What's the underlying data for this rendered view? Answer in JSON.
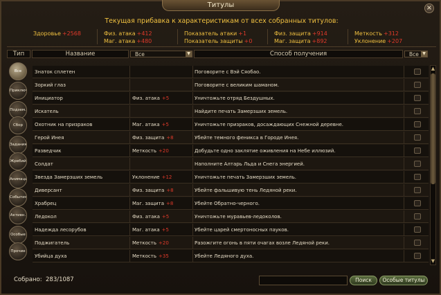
{
  "window": {
    "title": "Титулы",
    "close_glyph": "×"
  },
  "bonus": {
    "title": "Текущая прибавка к характеристикам от всех собранных титулов:",
    "stats": [
      {
        "label": "Здоровье",
        "value": "+2568"
      },
      {
        "label": "Физ. атака",
        "value": "+412"
      },
      {
        "label": "Маг. атака",
        "value": "+480"
      },
      {
        "label": "Показатель атаки",
        "value": "+1"
      },
      {
        "label": "Показатель защиты",
        "value": "+0"
      },
      {
        "label": "Физ. защита",
        "value": "+914"
      },
      {
        "label": "Маг. защита",
        "value": "+892"
      },
      {
        "label": "Меткость",
        "value": "+312"
      },
      {
        "label": "Уклонение",
        "value": "+207"
      }
    ]
  },
  "columns": {
    "type": "Тип",
    "name": "Название",
    "bonus_filter": "Все",
    "how": "Способ получения",
    "status_filter": "Все"
  },
  "filters": [
    "Все",
    "Приключ.",
    "Подзем.",
    "Сбор",
    "Задания",
    "Жребий",
    "Анимация",
    "События",
    "Активн.",
    "Особые",
    "Прочие"
  ],
  "rows": [
    {
      "name": "Знаток сплетен",
      "bonus": "",
      "bonus_value": "",
      "how": "Поговорите с Вэй Сяобао."
    },
    {
      "name": "Зоркий глаз",
      "bonus": "",
      "bonus_value": "",
      "how": "Поговорите с великим шаманом."
    },
    {
      "name": "Инициатор",
      "bonus": "Физ. атака",
      "bonus_value": "+5",
      "how": "Уничтожьте отряд Бездушных."
    },
    {
      "name": "Искатель",
      "bonus": "",
      "bonus_value": "",
      "how": "Найдите печать Замерзших земель."
    },
    {
      "name": "Охотник на призраков",
      "bonus": "Маг. атака",
      "bonus_value": "+5",
      "how": "Уничтожьте призраков, досаждающих Снежной деревне."
    },
    {
      "name": "Герой Инея",
      "bonus": "Физ. защита",
      "bonus_value": "+8",
      "how": "Убейте темного феникса в Городе Инея."
    },
    {
      "name": "Разведчик",
      "bonus": "Меткость",
      "bonus_value": "+20",
      "how": "Добудьте одно заклятие оживления на Небе иллюзий."
    },
    {
      "name": "Солдат",
      "bonus": "",
      "bonus_value": "",
      "how": "Наполните Алтарь Льда и Снега энергией."
    },
    {
      "name": "Звезда Замерзших земель",
      "bonus": "Уклонение",
      "bonus_value": "+12",
      "how": "Уничтожьте печать Замерзших земель."
    },
    {
      "name": "Диверсант",
      "bonus": "Физ. защита",
      "bonus_value": "+8",
      "how": "Убейте фальшивую тень Ледяной реки."
    },
    {
      "name": "Храбрец",
      "bonus": "Маг. защита",
      "bonus_value": "+8",
      "how": "Убейте Обратно-черного."
    },
    {
      "name": "Ледокол",
      "bonus": "Физ. атака",
      "bonus_value": "+5",
      "how": "Уничтожьте муравьев-ледоколов."
    },
    {
      "name": "Надежда лесорубов",
      "bonus": "Маг. атака",
      "bonus_value": "+5",
      "how": "Убейте царей смертоносных пауков."
    },
    {
      "name": "Поджигатель",
      "bonus": "Меткость",
      "bonus_value": "+20",
      "how": "Разожгите огонь в пяти очагах возле Ледяной реки."
    },
    {
      "name": "Убийца духа",
      "bonus": "Меткость",
      "bonus_value": "+35",
      "how": "Убейте Ледяного духа."
    }
  ],
  "footer": {
    "collected_label": "Собрано:",
    "collected_count": "283/1087",
    "search_value": "",
    "search_button": "Поиск",
    "special_button": "Особые титулы"
  },
  "colors": {
    "gold": "#f0c040",
    "bonus_red": "#e03a2a",
    "panel": "#1d1710"
  }
}
